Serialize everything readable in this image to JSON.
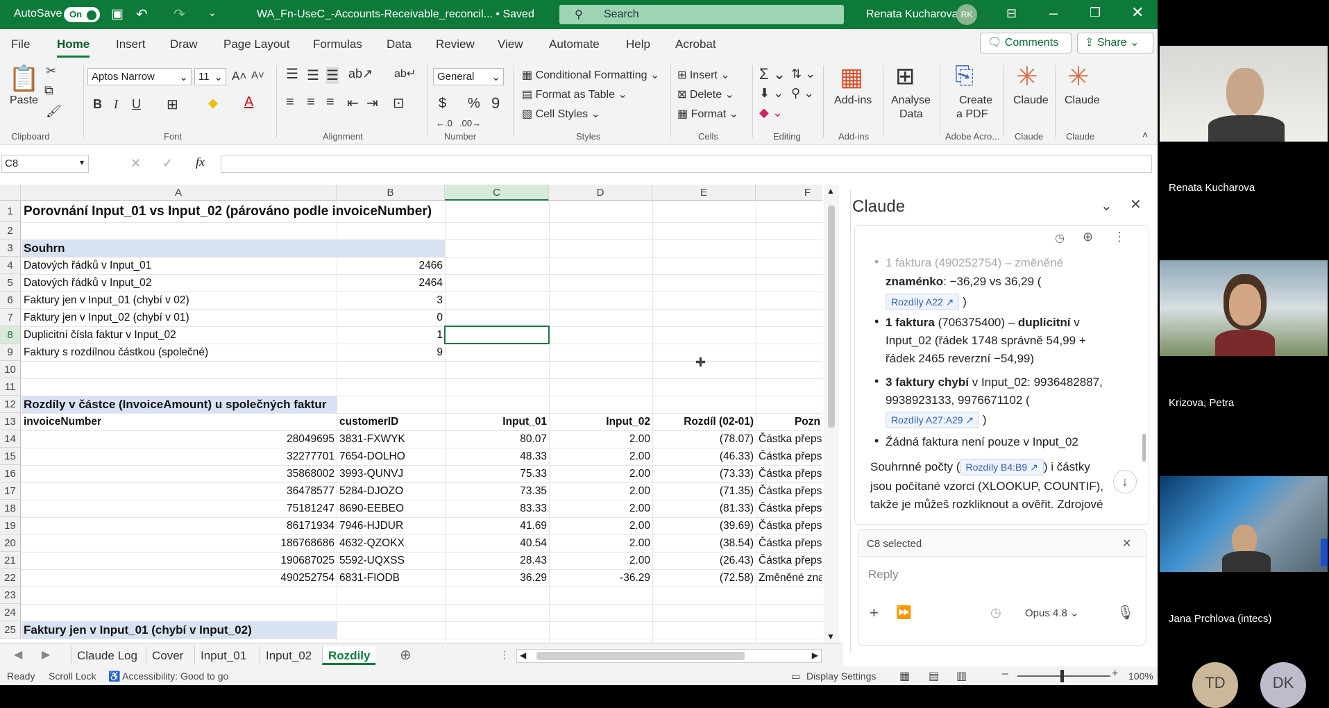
{
  "title_bar": {
    "autosave_label": "AutoSave",
    "autosave_state": "On",
    "filename": "WA_Fn-UseC_-Accounts-Receivable_reconcil... • Saved",
    "search_placeholder": "Search",
    "user_name": "Renata Kucharova",
    "user_initials": "RK"
  },
  "menu": {
    "items": [
      "File",
      "Home",
      "Insert",
      "Draw",
      "Page Layout",
      "Formulas",
      "Data",
      "Review",
      "View",
      "Automate",
      "Help",
      "Acrobat"
    ],
    "active": "Home",
    "comments_label": "Comments",
    "share_label": "Share"
  },
  "ribbon": {
    "clipboard": {
      "paste_label": "Paste",
      "group_label": "Clipboard"
    },
    "font": {
      "name": "Aptos Narrow",
      "size": "11",
      "group_label": "Font"
    },
    "alignment": {
      "group_label": "Alignment"
    },
    "number": {
      "format": "General",
      "group_label": "Number"
    },
    "styles": {
      "conditional": "Conditional Formatting",
      "table": "Format as Table",
      "cell_styles": "Cell Styles",
      "group_label": "Styles"
    },
    "cells": {
      "insert": "Insert",
      "delete": "Delete",
      "format": "Format",
      "group_label": "Cells"
    },
    "editing": {
      "group_label": "Editing"
    },
    "addins": {
      "label": "Add-ins",
      "group_label": "Add-ins"
    },
    "analyse": {
      "label1": "Analyse",
      "label2": "Data"
    },
    "pdf": {
      "label1": "Create",
      "label2": "a PDF",
      "group_label": "Adobe Acro..."
    },
    "claude1": {
      "label": "Claude",
      "group_label": "Claude"
    },
    "claude2": {
      "label": "Claude",
      "group_label": "Claude"
    }
  },
  "formula_bar": {
    "name_box": "C8",
    "formula": ""
  },
  "sheet": {
    "columns": [
      "A",
      "B",
      "C",
      "D",
      "E",
      "F"
    ],
    "row_numbers": [
      "1",
      "2",
      "3",
      "4",
      "5",
      "6",
      "7",
      "8",
      "9",
      "10",
      "11",
      "12",
      "13",
      "14",
      "15",
      "16",
      "17",
      "18",
      "19",
      "20",
      "21",
      "22",
      "23",
      "24",
      "25"
    ],
    "title": "Porovnání Input_01 vs Input_02 (párováno podle invoiceNumber)",
    "summary_header": "Souhrn",
    "summary": [
      {
        "label": "Datových řádků v Input_01",
        "value": "2466"
      },
      {
        "label": "Datových řádků v Input_02",
        "value": "2464"
      },
      {
        "label": "Faktury jen v Input_01 (chybí v 02)",
        "value": "3"
      },
      {
        "label": "Faktury jen v Input_02 (chybí v 01)",
        "value": "0"
      },
      {
        "label": "Duplicitní čísla faktur v Input_02",
        "value": "1"
      },
      {
        "label": "Faktury s rozdílnou částkou (společné)",
        "value": "9"
      }
    ],
    "diff_header": "Rozdíly v částce (InvoiceAmount) u společných faktur",
    "table_headers": [
      "invoiceNumber",
      "customerID",
      "Input_01",
      "Input_02",
      "Rozdíl (02-01)",
      "Pozn"
    ],
    "rows": [
      {
        "invoice": "28049695",
        "customer": "3831-FXWYK",
        "in1": "80.07",
        "in2": "2.00",
        "diff": "(78.07)",
        "note": "Částka přeps"
      },
      {
        "invoice": "32277701",
        "customer": "7654-DOLHO",
        "in1": "48.33",
        "in2": "2.00",
        "diff": "(46.33)",
        "note": "Částka přeps"
      },
      {
        "invoice": "35868002",
        "customer": "3993-QUNVJ",
        "in1": "75.33",
        "in2": "2.00",
        "diff": "(73.33)",
        "note": "Částka přeps"
      },
      {
        "invoice": "36478577",
        "customer": "5284-DJOZO",
        "in1": "73.35",
        "in2": "2.00",
        "diff": "(71.35)",
        "note": "Částka přeps"
      },
      {
        "invoice": "75181247",
        "customer": "8690-EEBEO",
        "in1": "83.33",
        "in2": "2.00",
        "diff": "(81.33)",
        "note": "Částka přeps"
      },
      {
        "invoice": "86171934",
        "customer": "7946-HJDUR",
        "in1": "41.69",
        "in2": "2.00",
        "diff": "(39.69)",
        "note": "Částka přeps"
      },
      {
        "invoice": "186768686",
        "customer": "4632-QZOKX",
        "in1": "40.54",
        "in2": "2.00",
        "diff": "(38.54)",
        "note": "Částka přeps"
      },
      {
        "invoice": "190687025",
        "customer": "5592-UQXSS",
        "in1": "28.43",
        "in2": "2.00",
        "diff": "(26.43)",
        "note": "Částka přeps"
      },
      {
        "invoice": "490252754",
        "customer": "6831-FIODB",
        "in1": "36.29",
        "in2": "-36.29",
        "diff": "(72.58)",
        "note": "Změněné zna"
      }
    ],
    "row25_text": "Faktury jen v Input_01 (chybí v Input_02)"
  },
  "sheet_tabs": {
    "tabs": [
      "Claude Log",
      "Cover",
      "Input_01",
      "Input_02",
      "Rozdily"
    ],
    "active": "Rozdily"
  },
  "status_bar": {
    "ready": "Ready",
    "scroll_lock": "Scroll Lock",
    "accessibility": "Accessibility: Good to go",
    "display_settings": "Display Settings",
    "zoom": "100%"
  },
  "claude_panel": {
    "title": "Claude",
    "msg1_faded": "1 faktura (490252754) – změněné",
    "msg1_bold": "znaménko",
    "msg1_rest": ": −36,29 vs 36,29 (",
    "chip1": "Rozdíly A22",
    "msg1_close": ")",
    "msg2_bold1": "1 faktura",
    "msg2_a": " (706375400) – ",
    "msg2_bold2": "duplicitní",
    "msg2_b": " v",
    "msg2_line2": "Input_02 (řádek 1748 správně 54,99 +",
    "msg2_line3": "řádek 2465 reverzní −54,99)",
    "msg3_bold": "3 faktury chybí",
    "msg3_a": " v Input_02: 9936482887,",
    "msg3_line2": "9938923133, 9976671102 (",
    "chip2": "Rozdíly A27:A29",
    "msg3_close": ")",
    "msg4": "Žádná faktura není pouze v Input_02",
    "msg5_a": "Souhrnné počty (",
    "chip3": "Rozdíly B4:B9",
    "msg5_b": ") i částky",
    "msg5_line2": "jsou počítané vzorci (XLOOKUP, COUNTIF),",
    "msg5_line3": "takže je můžeš rozkliknout a ověřit. Zdrojové",
    "selection_label": "C8 selected",
    "reply_placeholder": "Reply",
    "model": "Opus 4.8"
  },
  "participants": [
    {
      "name": "Renata Kucharova"
    },
    {
      "name": "Krizova, Petra"
    },
    {
      "name": "Jana Prchlova (intecs)"
    },
    {
      "initials": "TD"
    },
    {
      "initials": "DK"
    }
  ]
}
